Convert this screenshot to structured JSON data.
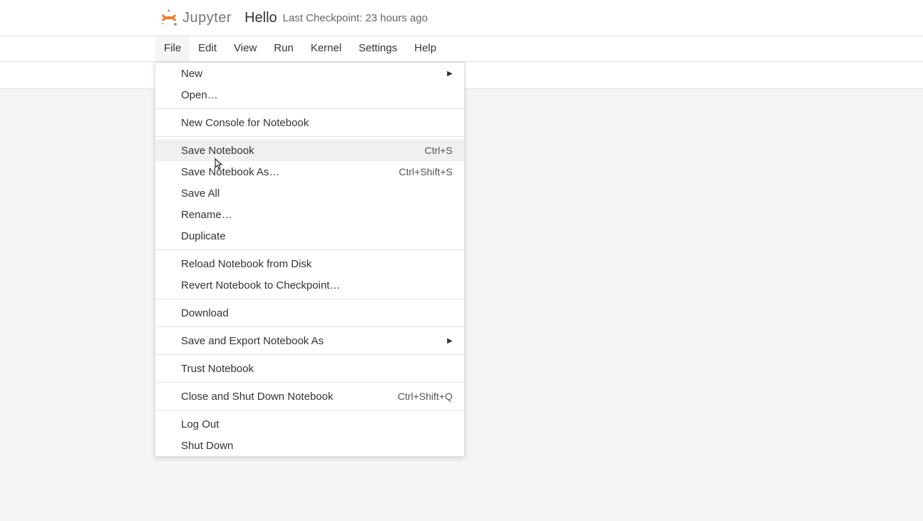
{
  "header": {
    "logo_text": "Jupyter",
    "notebook_name": "Hello",
    "checkpoint": "Last Checkpoint: 23 hours ago"
  },
  "menubar": {
    "items": [
      "File",
      "Edit",
      "View",
      "Run",
      "Kernel",
      "Settings",
      "Help"
    ]
  },
  "file_menu": {
    "groups": [
      [
        {
          "label": "New",
          "shortcut": "",
          "submenu": true
        },
        {
          "label": "Open…",
          "shortcut": "",
          "submenu": false
        }
      ],
      [
        {
          "label": "New Console for Notebook",
          "shortcut": "",
          "submenu": false
        }
      ],
      [
        {
          "label": "Save Notebook",
          "shortcut": "Ctrl+S",
          "submenu": false,
          "hover": true
        },
        {
          "label": "Save Notebook As…",
          "shortcut": "Ctrl+Shift+S",
          "submenu": false
        },
        {
          "label": "Save All",
          "shortcut": "",
          "submenu": false
        },
        {
          "label": "Rename…",
          "shortcut": "",
          "submenu": false
        },
        {
          "label": "Duplicate",
          "shortcut": "",
          "submenu": false
        }
      ],
      [
        {
          "label": "Reload Notebook from Disk",
          "shortcut": "",
          "submenu": false
        },
        {
          "label": "Revert Notebook to Checkpoint…",
          "shortcut": "",
          "submenu": false
        }
      ],
      [
        {
          "label": "Download",
          "shortcut": "",
          "submenu": false
        }
      ],
      [
        {
          "label": "Save and Export Notebook As",
          "shortcut": "",
          "submenu": true
        }
      ],
      [
        {
          "label": "Trust Notebook",
          "shortcut": "",
          "submenu": false
        }
      ],
      [
        {
          "label": "Close and Shut Down Notebook",
          "shortcut": "Ctrl+Shift+Q",
          "submenu": false
        }
      ],
      [
        {
          "label": "Log Out",
          "shortcut": "",
          "submenu": false
        },
        {
          "label": "Shut Down",
          "shortcut": "",
          "submenu": false
        }
      ]
    ]
  }
}
